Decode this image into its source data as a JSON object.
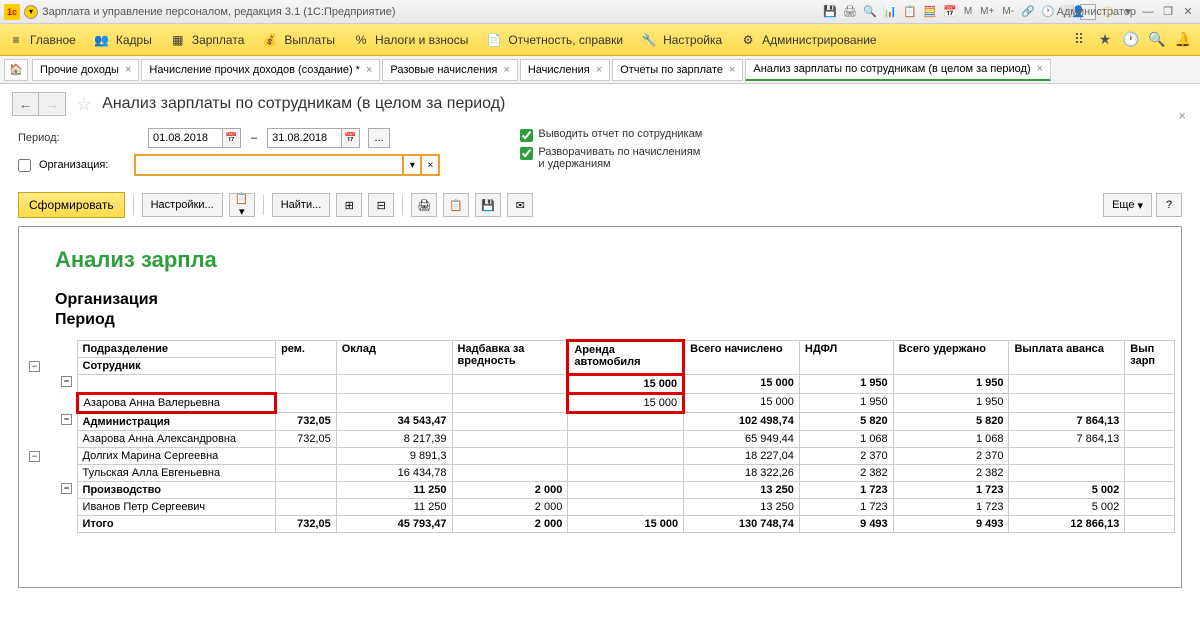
{
  "titlebar": {
    "app_name": "Зарплата и управление персоналом, редакция 3.1  (1С:Предприятие)",
    "admin": "Администратор"
  },
  "menu": {
    "main": "Главное",
    "staff": "Кадры",
    "salary": "Зарплата",
    "payments": "Выплаты",
    "taxes": "Налоги и взносы",
    "reports": "Отчетность, справки",
    "settings": "Настройка",
    "admin": "Администрирование"
  },
  "tabs": [
    {
      "label": "Прочие доходы"
    },
    {
      "label": "Начисление прочих доходов (создание) *"
    },
    {
      "label": "Разовые начисления"
    },
    {
      "label": "Начисления"
    },
    {
      "label": "Отчеты по зарплате"
    },
    {
      "label": "Анализ зарплаты по сотрудникам (в целом за период)"
    }
  ],
  "page_title": "Анализ зарплаты по сотрудникам (в целом за период)",
  "form": {
    "period_label": "Период:",
    "date_from": "01.08.2018",
    "date_to": "31.08.2018",
    "org_label": "Организация:",
    "chk1": "Выводить отчет по сотрудникам",
    "chk2": "Разворачивать по начислениям и удержаниям"
  },
  "actions": {
    "generate": "Сформировать",
    "settings": "Настройки...",
    "find": "Найти...",
    "more": "Еще"
  },
  "report": {
    "title": "Анализ зарпла",
    "sub1": "Организация",
    "sub2": "Период",
    "headers": {
      "dept": "Подразделение",
      "emp": "Сотрудник",
      "prem": "рем.",
      "oklad": "Оклад",
      "nadbavka": "Надбавка за вредность",
      "arenda": "Аренда автомобиля",
      "total_charged": "Всего начислено",
      "ndfl": "НДФЛ",
      "total_withheld": "Всего удержано",
      "advance": "Выплата аванса",
      "payout": "Вып зарп"
    },
    "rows": [
      {
        "name": "",
        "prem": "",
        "oklad": "",
        "nadb": "",
        "arenda": "15 000",
        "total_c": "15 000",
        "ndfl": "1 950",
        "total_w": "1 950",
        "adv": "",
        "tree": "minus",
        "bold": true,
        "red_arenda": true
      },
      {
        "name": "Азарова Анна Валерьевна",
        "prem": "",
        "oklad": "",
        "nadb": "",
        "arenda": "15 000",
        "total_c": "15 000",
        "ndfl": "1 950",
        "total_w": "1 950",
        "adv": "",
        "red_name": true,
        "red_arenda": true
      },
      {
        "name": "Администрация",
        "prem": "732,05",
        "oklad": "34 543,47",
        "nadb": "",
        "arenda": "",
        "total_c": "102 498,74",
        "ndfl": "5 820",
        "total_w": "5 820",
        "adv": "7 864,13",
        "tree": "minus",
        "bold": true
      },
      {
        "name": "Азарова Анна Александровна",
        "prem": "732,05",
        "oklad": "8 217,39",
        "nadb": "",
        "arenda": "",
        "total_c": "65 949,44",
        "ndfl": "1 068",
        "total_w": "1 068",
        "adv": "7 864,13"
      },
      {
        "name": "Долгих Марина Сергеевна",
        "prem": "",
        "oklad": "9 891,3",
        "nadb": "",
        "arenda": "",
        "total_c": "18 227,04",
        "ndfl": "2 370",
        "total_w": "2 370",
        "adv": ""
      },
      {
        "name": "Тульская Алла Евгеньевна",
        "prem": "",
        "oklad": "16 434,78",
        "nadb": "",
        "arenda": "",
        "total_c": "18 322,26",
        "ndfl": "2 382",
        "total_w": "2 382",
        "adv": ""
      },
      {
        "name": "Производство",
        "prem": "",
        "oklad": "11 250",
        "nadb": "2 000",
        "arenda": "",
        "total_c": "13 250",
        "ndfl": "1 723",
        "total_w": "1 723",
        "adv": "5 002",
        "tree": "minus",
        "bold": true
      },
      {
        "name": "Иванов Петр Сергеевич",
        "prem": "",
        "oklad": "11 250",
        "nadb": "2 000",
        "arenda": "",
        "total_c": "13 250",
        "ndfl": "1 723",
        "total_w": "1 723",
        "adv": "5 002"
      }
    ],
    "total": {
      "name": "Итого",
      "prem": "732,05",
      "oklad": "45 793,47",
      "nadb": "2 000",
      "arenda": "15 000",
      "total_c": "130 748,74",
      "ndfl": "9 493",
      "total_w": "9 493",
      "adv": "12 866,13"
    }
  }
}
